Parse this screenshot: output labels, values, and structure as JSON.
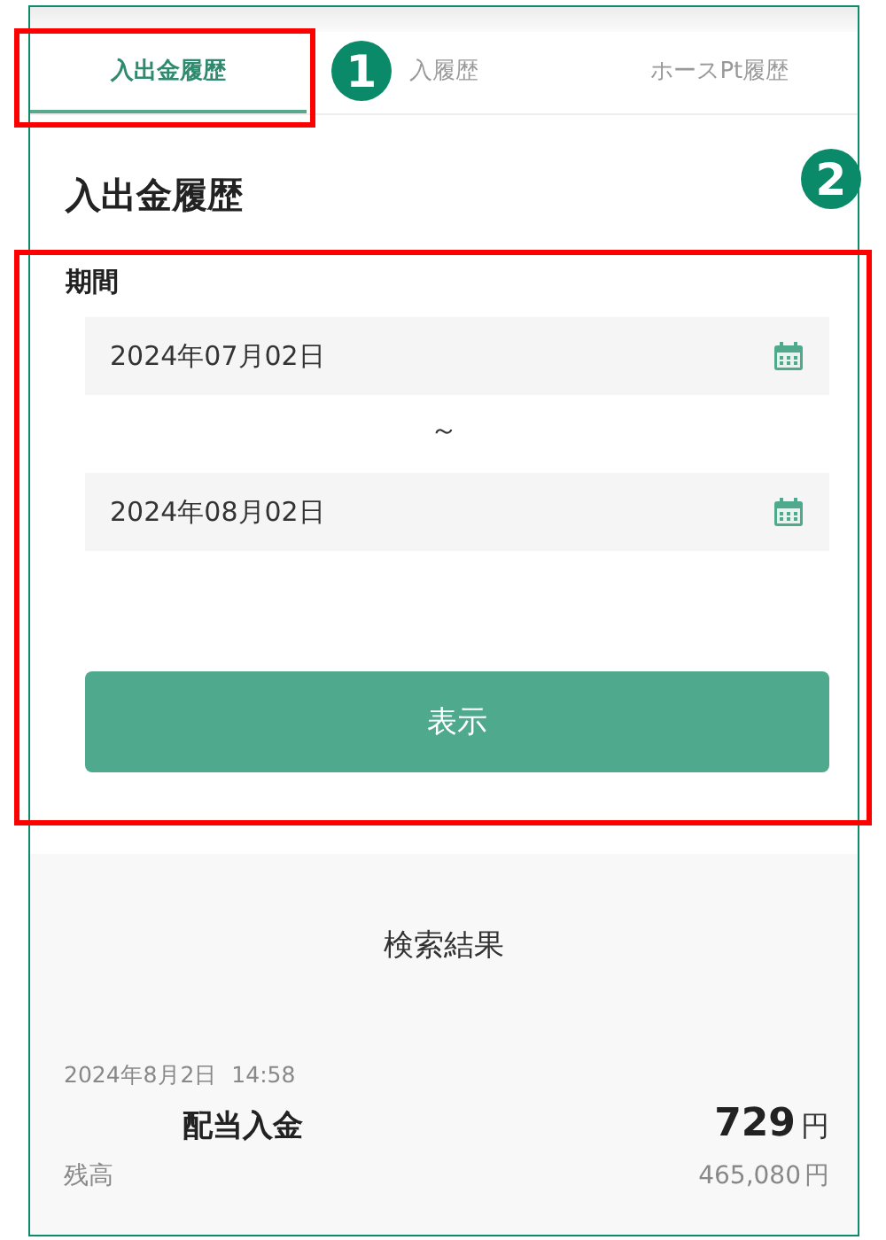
{
  "tabs": [
    {
      "label": "入出金履歴",
      "selected": true
    },
    {
      "label": "入履歴",
      "selected": false
    },
    {
      "label": "ホースPt履歴",
      "selected": false
    }
  ],
  "heading": "入出金履歴",
  "period": {
    "label": "期間",
    "from": "2024年07月02日",
    "separator": "～",
    "to": "2024年08月02日"
  },
  "show_button": "表示",
  "results": {
    "title": "検索結果",
    "entries": [
      {
        "datetime": "2024年8月2日  14:58",
        "type": "配当入金",
        "amount": "729",
        "amount_unit": "円",
        "balance_label": "残高",
        "balance": "465,080",
        "balance_unit": "円"
      }
    ]
  },
  "annotations": [
    {
      "label": "1"
    },
    {
      "label": "2"
    }
  ]
}
